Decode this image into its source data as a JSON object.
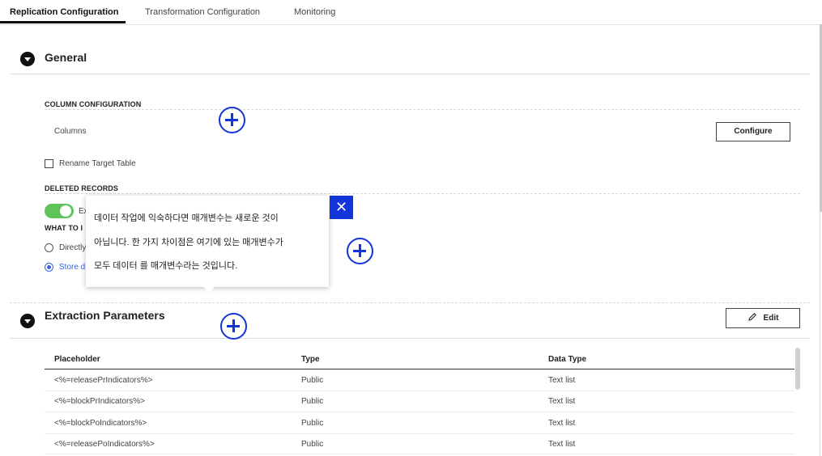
{
  "tabs": [
    {
      "label": "Replication Configuration",
      "active": true
    },
    {
      "label": "Transformation Configuration",
      "active": false
    },
    {
      "label": "Monitoring",
      "active": false
    }
  ],
  "general": {
    "title": "General",
    "column_config_heading": "COLUMN CONFIGURATION",
    "columns_label": "Columns",
    "configure_button": "Configure",
    "rename_target_table": "Rename Target Table",
    "rename_checked": false,
    "deleted_records_heading": "DELETED RECORDS",
    "switch_label_visible": "Ex",
    "switch_on": true,
    "what_to_heading_visible": "WHAT TO I",
    "radio_options_visible": [
      "Directly",
      "Store d"
    ],
    "radio_selected_index": 1
  },
  "tooltip": {
    "lines": [
      "데이터 작업에 익숙하다면 매개변수는 새로운 것이",
      "아닙니다. 한 가지 차이점은 여기에 있는 매개변수가",
      "모두 데이터 를 매개변수라는 것입니다."
    ],
    "close_glyph": "✕"
  },
  "extraction": {
    "title": "Extraction Parameters",
    "edit_button": "Edit",
    "edit_icon": "pencil-icon",
    "columns": [
      "Placeholder",
      "Type",
      "Data Type"
    ],
    "rows": [
      [
        "<%=releasePrIndicators%>",
        "Public",
        "Text list"
      ],
      [
        "<%=blockPrIndicators%>",
        "Public",
        "Text list"
      ],
      [
        "<%=blockPoIndicators%>",
        "Public",
        "Text list"
      ],
      [
        "<%=releasePoIndicators%>",
        "Public",
        "Text list"
      ]
    ]
  },
  "colors": {
    "accent": "#1234d8",
    "switch_on": "#5ec45a",
    "radio": "#3b63e0"
  }
}
